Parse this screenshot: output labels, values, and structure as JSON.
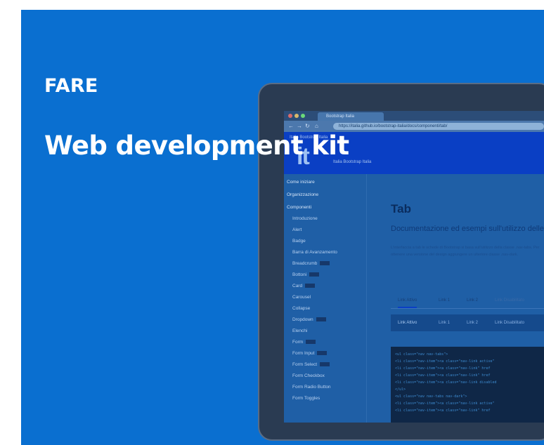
{
  "banner": {
    "eyebrow": "FARE",
    "headline": "Web development kit",
    "background": "#0a6fd0"
  },
  "browser": {
    "tab_title": "Bootstrap Italia",
    "url": "https://italia.github.io/bootstrap-italia/docs/componenti/tab/"
  },
  "site": {
    "logo": "it",
    "top_links": "Italia   Bootstrap Italia",
    "tagline": "Italia Bootstrap Italia"
  },
  "sidebar": {
    "items": [
      {
        "label": "Come iniziare",
        "badge": false,
        "head": true
      },
      {
        "label": "Organizzazione",
        "badge": false,
        "head": true
      },
      {
        "label": "Componenti",
        "badge": false,
        "head": true
      },
      {
        "label": "Introduzione",
        "badge": false
      },
      {
        "label": "Alert",
        "badge": false
      },
      {
        "label": "Badge",
        "badge": false
      },
      {
        "label": "Barra di Avanzamento",
        "badge": false
      },
      {
        "label": "Breadcrumb",
        "badge": true
      },
      {
        "label": "Bottoni",
        "badge": true
      },
      {
        "label": "Card",
        "badge": true
      },
      {
        "label": "Carousel",
        "badge": false
      },
      {
        "label": "Collapse",
        "badge": false
      },
      {
        "label": "Dropdown",
        "badge": true
      },
      {
        "label": "Elenchi",
        "badge": false
      },
      {
        "label": "Form",
        "badge": true
      },
      {
        "label": "Form Input",
        "badge": true
      },
      {
        "label": "Form Select",
        "badge": true
      },
      {
        "label": "Form Checkbox",
        "badge": false
      },
      {
        "label": "Form Radio Button",
        "badge": false
      },
      {
        "label": "Form Toggles",
        "badge": false
      }
    ]
  },
  "content": {
    "title": "Tab",
    "subtitle": "Documentazione ed esempi sull'utilizzo delle tab",
    "paragraph": "L'interfaccia a tab le schede di Bootstrap si basa sull'utilizzo della classe .nav-tabs. Per ottenere una versione del design aggiungere un ulteriore classe .nav-dark.",
    "tabs_light": [
      "Link Attivo",
      "Link 1",
      "Link 2",
      "Link Disabilitato"
    ],
    "tabs_dark": [
      "Link Attivo",
      "Link 1",
      "Link 2",
      "Link Disabilitato"
    ],
    "code_lines": [
      "<ul class=\"nav nav-tabs\">",
      "  <li class=\"nav-item\"><a class=\"nav-link active\"",
      "  <li class=\"nav-item\"><a class=\"nav-link\" href",
      "  <li class=\"nav-item\"><a class=\"nav-link\" href",
      "  <li class=\"nav-item\"><a class=\"nav-link disabled",
      "</ul>",
      "<ul class=\"nav nav-tabs nav-dark\">",
      "  <li class=\"nav-item\"><a class=\"nav-link active\"",
      "  <li class=\"nav-item\"><a class=\"nav-link\" href"
    ]
  }
}
